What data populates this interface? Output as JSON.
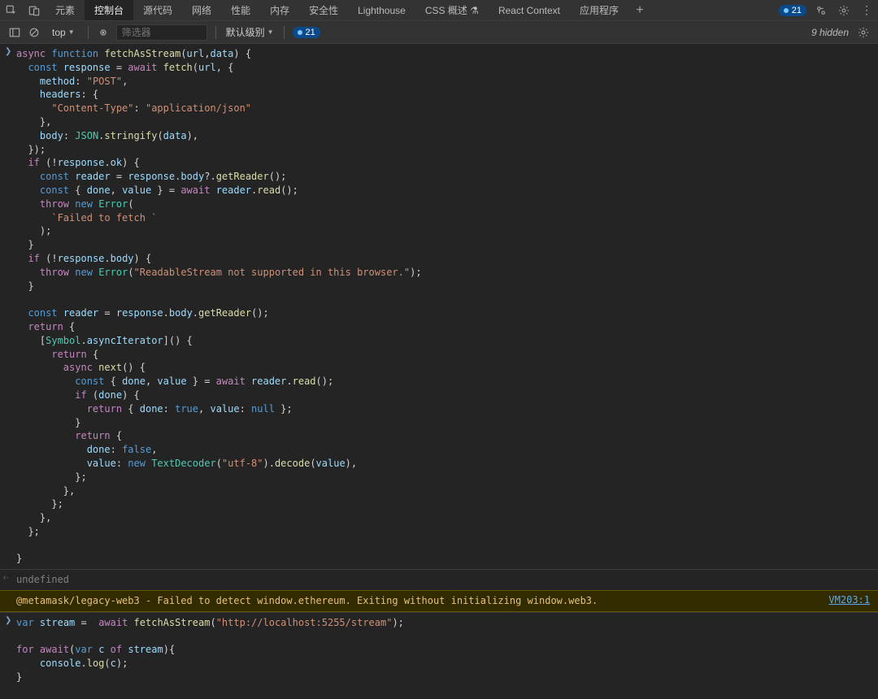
{
  "tabs": {
    "items": [
      "元素",
      "控制台",
      "源代码",
      "网络",
      "性能",
      "内存",
      "安全性",
      "Lighthouse",
      "CSS 概述 ⚗",
      "React Context",
      "应用程序"
    ],
    "active_index": 1
  },
  "top_badge": "21",
  "toolbar": {
    "context": "top",
    "filter_placeholder": "筛选器",
    "level_label": "默认级别",
    "info_badge": "21",
    "hidden_label": "9 hidden"
  },
  "console_entries": {
    "code1": {
      "lines": [
        [
          [
            "kw",
            "async"
          ],
          [
            "pun",
            " "
          ],
          [
            "kw2",
            "function"
          ],
          [
            "pun",
            " "
          ],
          [
            "fn",
            "fetchAsStream"
          ],
          [
            "pun",
            "("
          ],
          [
            "var",
            "url"
          ],
          [
            "pun",
            ","
          ],
          [
            "var",
            "data"
          ],
          [
            "pun",
            ") {"
          ]
        ],
        [
          [
            "pun",
            "  "
          ],
          [
            "kw2",
            "const"
          ],
          [
            "pun",
            " "
          ],
          [
            "var",
            "response"
          ],
          [
            "pun",
            " = "
          ],
          [
            "kw",
            "await"
          ],
          [
            "pun",
            " "
          ],
          [
            "fn",
            "fetch"
          ],
          [
            "pun",
            "("
          ],
          [
            "var",
            "url"
          ],
          [
            "pun",
            ", {"
          ]
        ],
        [
          [
            "pun",
            "    "
          ],
          [
            "var",
            "method"
          ],
          [
            "pun",
            ": "
          ],
          [
            "str",
            "\"POST\""
          ],
          [
            "pun",
            ","
          ]
        ],
        [
          [
            "pun",
            "    "
          ],
          [
            "var",
            "headers"
          ],
          [
            "pun",
            ": {"
          ]
        ],
        [
          [
            "pun",
            "      "
          ],
          [
            "str",
            "\"Content-Type\""
          ],
          [
            "pun",
            ": "
          ],
          [
            "str",
            "\"application/json\""
          ]
        ],
        [
          [
            "pun",
            "    },"
          ]
        ],
        [
          [
            "pun",
            "    "
          ],
          [
            "var",
            "body"
          ],
          [
            "pun",
            ": "
          ],
          [
            "obj",
            "JSON"
          ],
          [
            "pun",
            "."
          ],
          [
            "fn",
            "stringify"
          ],
          [
            "pun",
            "("
          ],
          [
            "var",
            "data"
          ],
          [
            "pun",
            "),"
          ]
        ],
        [
          [
            "pun",
            "  });"
          ]
        ],
        [
          [
            "pun",
            "  "
          ],
          [
            "kw",
            "if"
          ],
          [
            "pun",
            " (!"
          ],
          [
            "var",
            "response"
          ],
          [
            "pun",
            "."
          ],
          [
            "var",
            "ok"
          ],
          [
            "pun",
            ") {"
          ]
        ],
        [
          [
            "pun",
            "    "
          ],
          [
            "kw2",
            "const"
          ],
          [
            "pun",
            " "
          ],
          [
            "var",
            "reader"
          ],
          [
            "pun",
            " = "
          ],
          [
            "var",
            "response"
          ],
          [
            "pun",
            "."
          ],
          [
            "var",
            "body"
          ],
          [
            "pun",
            "?."
          ],
          [
            "fn",
            "getReader"
          ],
          [
            "pun",
            "();"
          ]
        ],
        [
          [
            "pun",
            "    "
          ],
          [
            "kw2",
            "const"
          ],
          [
            "pun",
            " { "
          ],
          [
            "var",
            "done"
          ],
          [
            "pun",
            ", "
          ],
          [
            "var",
            "value"
          ],
          [
            "pun",
            " } = "
          ],
          [
            "kw",
            "await"
          ],
          [
            "pun",
            " "
          ],
          [
            "var",
            "reader"
          ],
          [
            "pun",
            "."
          ],
          [
            "fn",
            "read"
          ],
          [
            "pun",
            "();"
          ]
        ],
        [
          [
            "pun",
            "    "
          ],
          [
            "kw",
            "throw"
          ],
          [
            "pun",
            " "
          ],
          [
            "kw2",
            "new"
          ],
          [
            "pun",
            " "
          ],
          [
            "obj",
            "Error"
          ],
          [
            "pun",
            "("
          ]
        ],
        [
          [
            "pun",
            "      "
          ],
          [
            "btk",
            "`Failed to fetch `"
          ]
        ],
        [
          [
            "pun",
            "    );"
          ]
        ],
        [
          [
            "pun",
            "  }"
          ]
        ],
        [
          [
            "pun",
            "  "
          ],
          [
            "kw",
            "if"
          ],
          [
            "pun",
            " (!"
          ],
          [
            "var",
            "response"
          ],
          [
            "pun",
            "."
          ],
          [
            "var",
            "body"
          ],
          [
            "pun",
            ") {"
          ]
        ],
        [
          [
            "pun",
            "    "
          ],
          [
            "kw",
            "throw"
          ],
          [
            "pun",
            " "
          ],
          [
            "kw2",
            "new"
          ],
          [
            "pun",
            " "
          ],
          [
            "obj",
            "Error"
          ],
          [
            "pun",
            "("
          ],
          [
            "str",
            "\"ReadableStream not supported in this browser.\""
          ],
          [
            "pun",
            ");"
          ]
        ],
        [
          [
            "pun",
            "  }"
          ]
        ],
        [
          [
            "pun",
            ""
          ]
        ],
        [
          [
            "pun",
            "  "
          ],
          [
            "kw2",
            "const"
          ],
          [
            "pun",
            " "
          ],
          [
            "var",
            "reader"
          ],
          [
            "pun",
            " = "
          ],
          [
            "var",
            "response"
          ],
          [
            "pun",
            "."
          ],
          [
            "var",
            "body"
          ],
          [
            "pun",
            "."
          ],
          [
            "fn",
            "getReader"
          ],
          [
            "pun",
            "();"
          ]
        ],
        [
          [
            "pun",
            "  "
          ],
          [
            "kw",
            "return"
          ],
          [
            "pun",
            " {"
          ]
        ],
        [
          [
            "pun",
            "    ["
          ],
          [
            "obj",
            "Symbol"
          ],
          [
            "pun",
            "."
          ],
          [
            "var",
            "asyncIterator"
          ],
          [
            "pun",
            "]() {"
          ]
        ],
        [
          [
            "pun",
            "      "
          ],
          [
            "kw",
            "return"
          ],
          [
            "pun",
            " {"
          ]
        ],
        [
          [
            "pun",
            "        "
          ],
          [
            "kw",
            "async"
          ],
          [
            "pun",
            " "
          ],
          [
            "fn",
            "next"
          ],
          [
            "pun",
            "() {"
          ]
        ],
        [
          [
            "pun",
            "          "
          ],
          [
            "kw2",
            "const"
          ],
          [
            "pun",
            " { "
          ],
          [
            "var",
            "done"
          ],
          [
            "pun",
            ", "
          ],
          [
            "var",
            "value"
          ],
          [
            "pun",
            " } = "
          ],
          [
            "kw",
            "await"
          ],
          [
            "pun",
            " "
          ],
          [
            "var",
            "reader"
          ],
          [
            "pun",
            "."
          ],
          [
            "fn",
            "read"
          ],
          [
            "pun",
            "();"
          ]
        ],
        [
          [
            "pun",
            "          "
          ],
          [
            "kw",
            "if"
          ],
          [
            "pun",
            " ("
          ],
          [
            "var",
            "done"
          ],
          [
            "pun",
            ") {"
          ]
        ],
        [
          [
            "pun",
            "            "
          ],
          [
            "kw",
            "return"
          ],
          [
            "pun",
            " { "
          ],
          [
            "var",
            "done"
          ],
          [
            "pun",
            ": "
          ],
          [
            "lit",
            "true"
          ],
          [
            "pun",
            ", "
          ],
          [
            "var",
            "value"
          ],
          [
            "pun",
            ": "
          ],
          [
            "lit",
            "null"
          ],
          [
            "pun",
            " };"
          ]
        ],
        [
          [
            "pun",
            "          }"
          ]
        ],
        [
          [
            "pun",
            "          "
          ],
          [
            "kw",
            "return"
          ],
          [
            "pun",
            " {"
          ]
        ],
        [
          [
            "pun",
            "            "
          ],
          [
            "var",
            "done"
          ],
          [
            "pun",
            ": "
          ],
          [
            "lit",
            "false"
          ],
          [
            "pun",
            ","
          ]
        ],
        [
          [
            "pun",
            "            "
          ],
          [
            "var",
            "value"
          ],
          [
            "pun",
            ": "
          ],
          [
            "kw2",
            "new"
          ],
          [
            "pun",
            " "
          ],
          [
            "obj",
            "TextDecoder"
          ],
          [
            "pun",
            "("
          ],
          [
            "str",
            "\"utf-8\""
          ],
          [
            "pun",
            ")."
          ],
          [
            "fn",
            "decode"
          ],
          [
            "pun",
            "("
          ],
          [
            "var",
            "value"
          ],
          [
            "pun",
            "),"
          ]
        ],
        [
          [
            "pun",
            "          };"
          ]
        ],
        [
          [
            "pun",
            "        },"
          ]
        ],
        [
          [
            "pun",
            "      };"
          ]
        ],
        [
          [
            "pun",
            "    },"
          ]
        ],
        [
          [
            "pun",
            "  };"
          ]
        ],
        [
          [
            "pun",
            ""
          ]
        ],
        [
          [
            "pun",
            "}"
          ]
        ]
      ]
    },
    "output1": "undefined",
    "warn1": "@metamask/legacy-web3 - Failed to detect window.ethereum. Exiting without initializing window.web3.",
    "warn1_link": "VM203:1",
    "code2": {
      "lines": [
        [
          [
            "kw2",
            "var"
          ],
          [
            "pun",
            " "
          ],
          [
            "var",
            "stream"
          ],
          [
            "pun",
            " =  "
          ],
          [
            "kw",
            "await"
          ],
          [
            "pun",
            " "
          ],
          [
            "fn",
            "fetchAsStream"
          ],
          [
            "pun",
            "("
          ],
          [
            "str",
            "\"http://localhost:5255/stream\""
          ],
          [
            "pun",
            ");"
          ]
        ],
        [
          [
            "pun",
            ""
          ]
        ],
        [
          [
            "kw",
            "for"
          ],
          [
            "pun",
            " "
          ],
          [
            "kw",
            "await"
          ],
          [
            "pun",
            "("
          ],
          [
            "kw2",
            "var"
          ],
          [
            "pun",
            " "
          ],
          [
            "var",
            "c"
          ],
          [
            "pun",
            " "
          ],
          [
            "kw",
            "of"
          ],
          [
            "pun",
            " "
          ],
          [
            "var",
            "stream"
          ],
          [
            "pun",
            "){"
          ]
        ],
        [
          [
            "pun",
            "    "
          ],
          [
            "var",
            "console"
          ],
          [
            "pun",
            "."
          ],
          [
            "fn",
            "log"
          ],
          [
            "pun",
            "("
          ],
          [
            "var",
            "c"
          ],
          [
            "pun",
            ");"
          ]
        ],
        [
          [
            "pun",
            "}"
          ]
        ]
      ]
    }
  }
}
